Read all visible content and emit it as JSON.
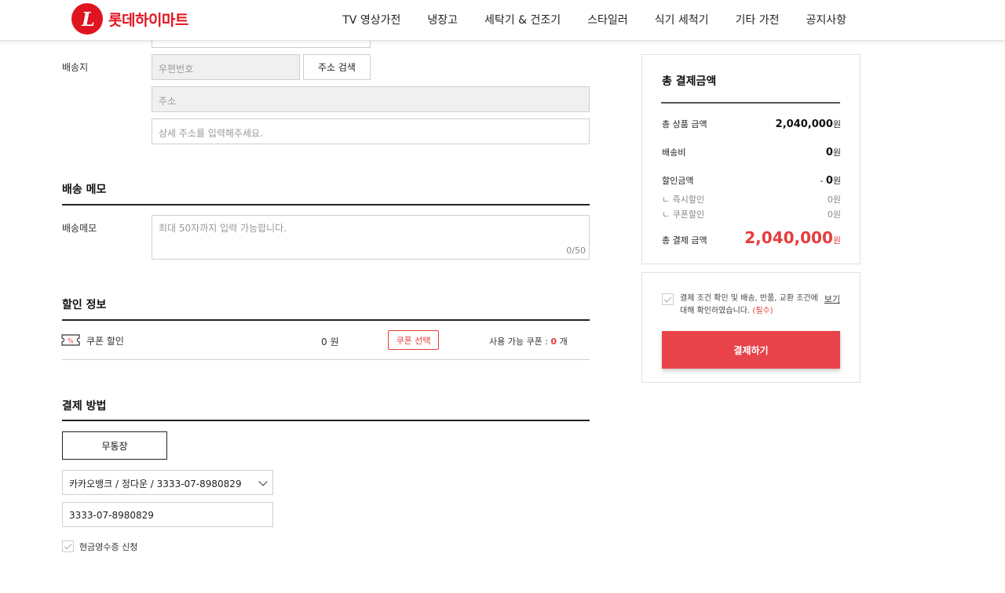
{
  "brand": {
    "name": "롯데하이마트",
    "mark": "L"
  },
  "nav": [
    "TV 영상가전",
    "냉장고",
    "세탁기 & 건조기",
    "스타일러",
    "식기 세척기",
    "기타 가전",
    "공지사항"
  ],
  "address": {
    "label": "배송지",
    "postcode_placeholder": "우편번호",
    "search_button": "주소 검색",
    "address_placeholder": "주소",
    "detail_placeholder": "상세 주소를 입력해주세요."
  },
  "memo": {
    "title": "배송 메모",
    "label": "배송메모",
    "placeholder": "최대 50자까지 입력 가능합니다.",
    "counter": "0/50"
  },
  "discount": {
    "title": "할인 정보",
    "coupon_label": "쿠폰 할인",
    "amount": "0 원",
    "coupon_button": "쿠폰 선택",
    "available_prefix": "사용 가능 쿠폰 :",
    "available_count": "0",
    "available_unit": "개"
  },
  "payment": {
    "title": "결제 방법",
    "method_button": "무통장",
    "bank_selected": "카카오뱅크 / 정다운 / 3333-07-8980829",
    "account_value": "3333-07-8980829",
    "receipt_label": "현금영수증 신청"
  },
  "summary": {
    "title": "총 결제금액",
    "rows": {
      "product_label": "총 상품 금액",
      "product_value": "2,040,000",
      "product_unit": "원",
      "shipping_label": "배송비",
      "shipping_value": "0",
      "shipping_unit": "원",
      "discount_label": "할인금액",
      "discount_sign": "- ",
      "discount_value": "0",
      "discount_unit": "원",
      "instant_label": "ㄴ 즉시할인",
      "instant_value": "0원",
      "coupon_label": "ㄴ 쿠폰할인",
      "coupon_value": "0원",
      "total_label": "총 결제 금액",
      "total_value": "2,040,000",
      "total_unit": "원"
    }
  },
  "agreement": {
    "text": "결제 조건 확인 및 배송, 반품, 교환 조건에 대해 확인하였습니다.",
    "required": "(필수)",
    "view_link": "보기",
    "checkout_button": "결제하기"
  },
  "colors": {
    "brand": "#e0141e",
    "accent": "#e8434a"
  }
}
